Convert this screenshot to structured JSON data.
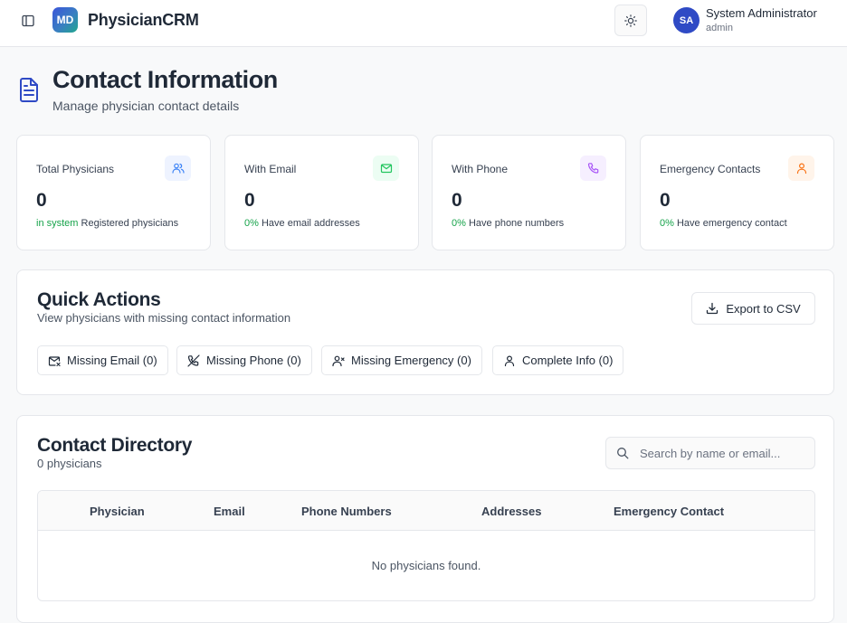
{
  "header": {
    "logo_text": "MD",
    "app_name": "PhysicianCRM",
    "user": {
      "initials": "SA",
      "name": "System Administrator",
      "role": "admin"
    }
  },
  "page": {
    "title": "Contact Information",
    "subtitle": "Manage physician contact details"
  },
  "stats": [
    {
      "label": "Total Physicians",
      "value": "0",
      "highlight": "in system",
      "note": "Registered physicians",
      "icon": "users-icon",
      "color": "#3b82f6"
    },
    {
      "label": "With Email",
      "value": "0",
      "highlight": "0%",
      "note": "Have email addresses",
      "icon": "mail-icon",
      "color": "#22c55e"
    },
    {
      "label": "With Phone",
      "value": "0",
      "highlight": "0%",
      "note": "Have phone numbers",
      "icon": "phone-icon",
      "color": "#a855f7"
    },
    {
      "label": "Emergency Contacts",
      "value": "0",
      "highlight": "0%",
      "note": "Have emergency contact",
      "icon": "user-icon",
      "color": "#f97316"
    }
  ],
  "quick_actions": {
    "title": "Quick Actions",
    "subtitle": "View physicians with missing contact information",
    "export_label": "Export to CSV",
    "filters": [
      {
        "label": "Missing Email (0)",
        "icon": "mail-x-icon"
      },
      {
        "label": "Missing Phone (0)",
        "icon": "phone-off-icon"
      },
      {
        "label": "Missing Emergency (0)",
        "icon": "user-x-icon"
      },
      {
        "label": "Complete Info (0)",
        "icon": "user-icon"
      }
    ]
  },
  "directory": {
    "title": "Contact Directory",
    "count": "0 physicians",
    "search_placeholder": "Search by name or email...",
    "columns": [
      "Physician",
      "Email",
      "Phone Numbers",
      "Addresses",
      "Emergency Contact"
    ],
    "empty_message": "No physicians found."
  }
}
